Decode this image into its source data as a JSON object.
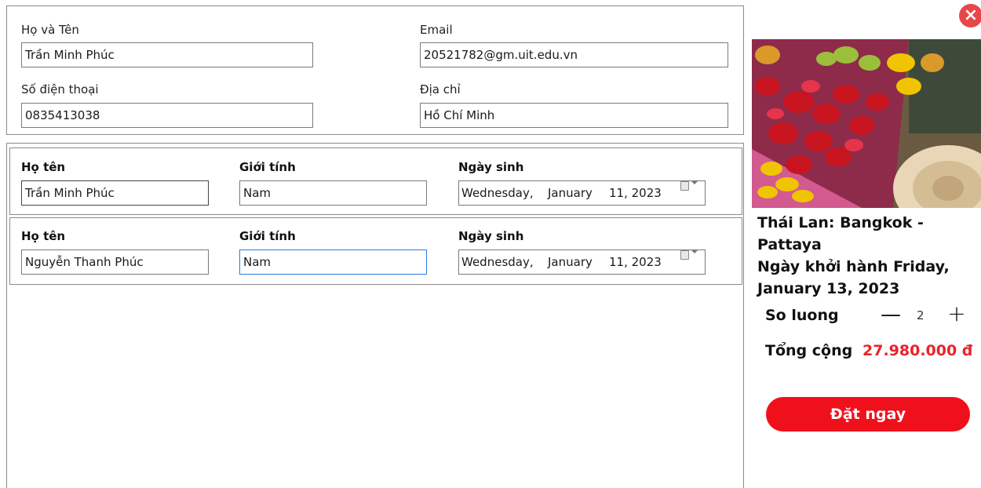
{
  "contact": {
    "name_label": "Họ và Tên",
    "name_value": "Trần Minh Phúc",
    "email_label": "Email",
    "email_value": "20521782@gm.uit.edu.vn",
    "phone_label": "Số điện thoại",
    "phone_value": "0835413038",
    "address_label": "Địa chỉ",
    "address_value": "Hồ Chí Minh"
  },
  "passengers": [
    {
      "name_label": "Họ tên",
      "name_value": "Trần Minh Phúc",
      "gender_label": "Giới tính",
      "gender_value": "Nam",
      "dob_label": "Ngày sinh",
      "dob_weekday": "Wednesday,",
      "dob_month": "January",
      "dob_day_year": "11, 2023"
    },
    {
      "name_label": "Họ tên",
      "name_value": "Nguyễn Thanh Phúc",
      "gender_label": "Giới tính",
      "gender_value": "Nam",
      "dob_label": "Ngày sinh",
      "dob_weekday": "Wednesday,",
      "dob_month": "January",
      "dob_day_year": "11, 2023"
    }
  ],
  "tour": {
    "image_icon": "market-fruit-photo",
    "title_line1": "Thái Lan: Bangkok - Pattaya",
    "title_line2": "Ngày khởi hành Friday,",
    "title_line3": "January 13, 2023"
  },
  "order": {
    "quantity_label": "So luong",
    "minus_symbol": "—",
    "quantity": "2",
    "plus_symbol": "+",
    "total_label": "Tổng cộng",
    "total_value": "27.980.000 đ",
    "book_label": "Đặt ngay"
  },
  "close_symbol": "×",
  "colors": {
    "accent_red": "#f0101c",
    "total_red": "#e8232a",
    "close_red": "#e8474a",
    "focus_blue": "#2b7de0"
  }
}
